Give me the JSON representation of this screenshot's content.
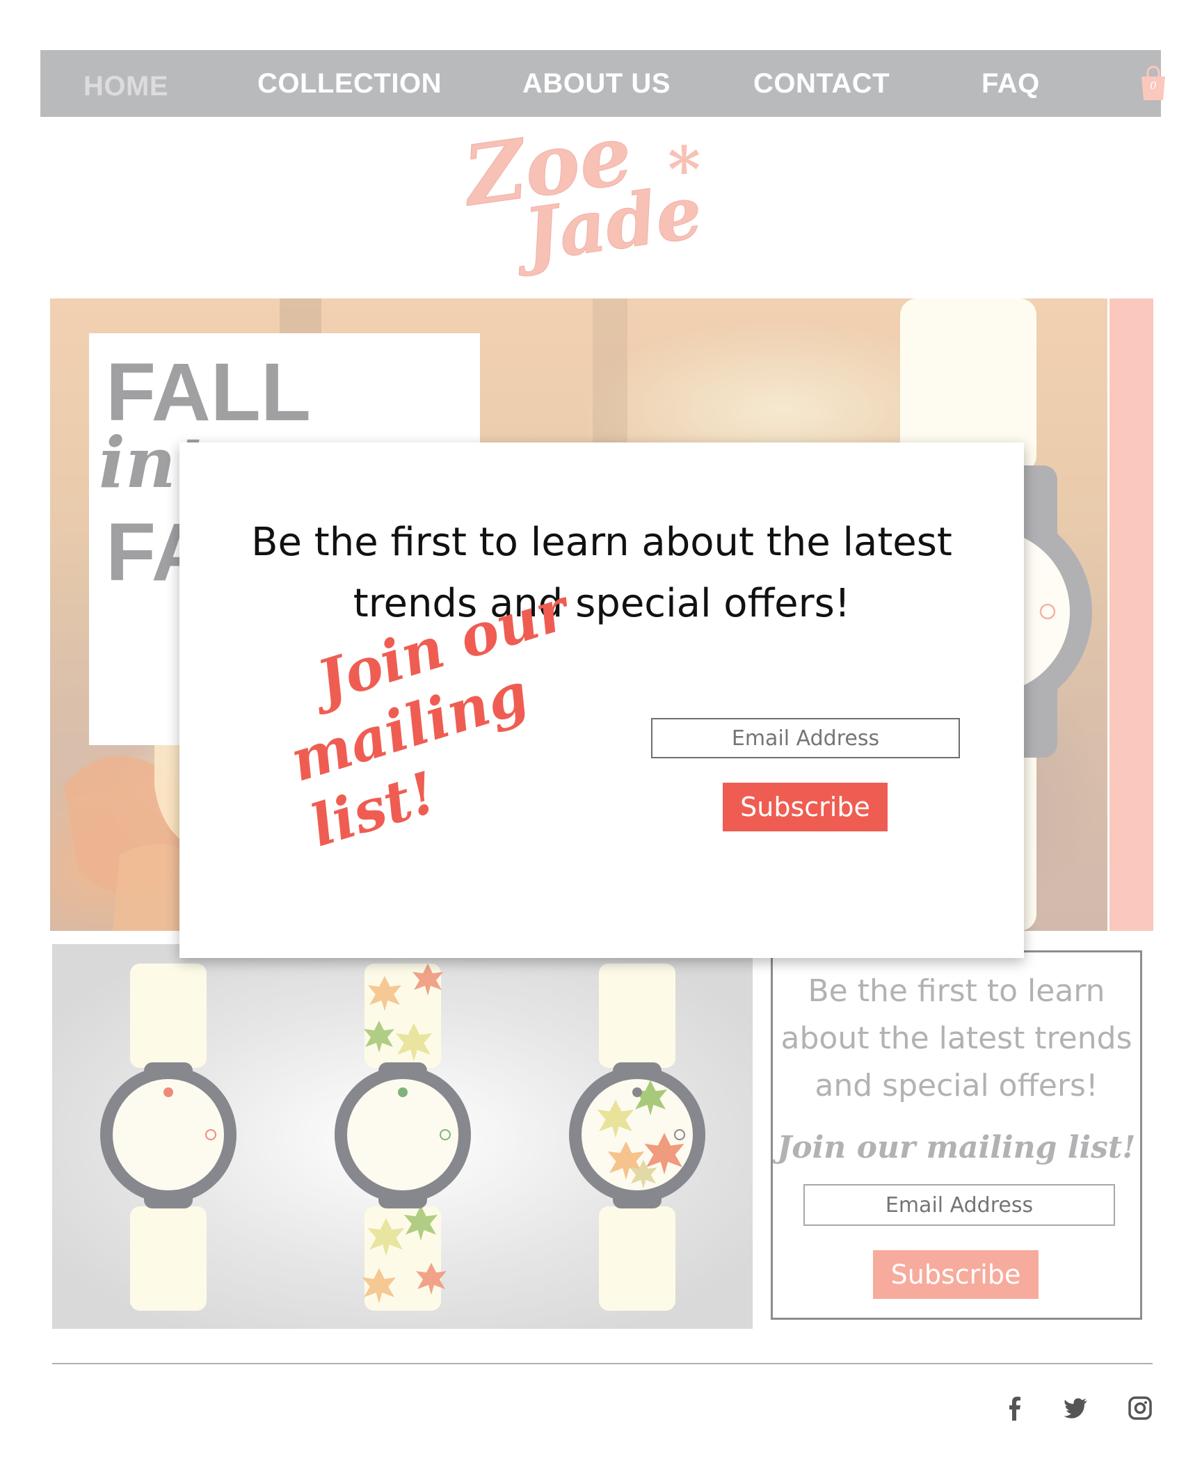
{
  "nav": {
    "items": [
      {
        "label": "HOME",
        "active": true
      },
      {
        "label": "COLLECTION"
      },
      {
        "label": "ABOUT US"
      },
      {
        "label": "CONTACT"
      },
      {
        "label": "FAQ"
      }
    ],
    "cart_count": "0",
    "cart_icon": "shopping-bag-icon"
  },
  "logo": {
    "line1": "Zoe",
    "line2": "Jade",
    "star": "*"
  },
  "hero": {
    "title": "FALL",
    "script": "into",
    "title2": "FA"
  },
  "modal": {
    "heading_line1": "Be the first to learn about the latest",
    "heading_line2": "trends and special offers!",
    "join_line1": "Join our",
    "join_line2": "mailing list!",
    "email_placeholder": "Email Address",
    "subscribe_label": "Subscribe"
  },
  "signup": {
    "heading_line1": "Be the first to learn",
    "heading_line2": "about the latest trends",
    "heading_line3": "and special offers!",
    "join": "Join our mailing list!",
    "email_placeholder": "Email Address",
    "subscribe_label": "Subscribe"
  },
  "social": [
    "facebook-icon",
    "twitter-icon",
    "instagram-icon"
  ],
  "colors": {
    "nav_bg": "#949598",
    "brand_coral": "#ef5d52",
    "light_coral": "#f8ab99",
    "gray_text": "#6d6e72",
    "watch_gray": "#87888d",
    "strap_cream": "#fdfbe8"
  }
}
